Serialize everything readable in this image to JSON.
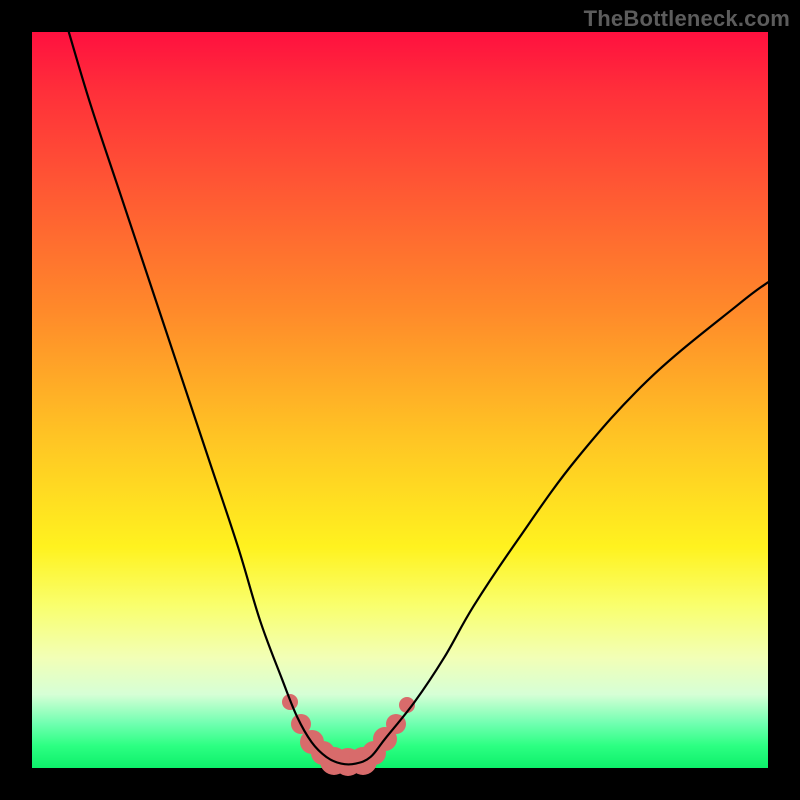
{
  "watermark": "TheBottleneck.com",
  "chart_data": {
    "type": "line",
    "title": "",
    "xlabel": "",
    "ylabel": "",
    "xlim": [
      0,
      100
    ],
    "ylim": [
      0,
      100
    ],
    "grid": false,
    "legend": false,
    "series": [
      {
        "name": "bottleneck-curve",
        "x": [
          5,
          8,
          12,
          16,
          20,
          24,
          28,
          31,
          34,
          36,
          38,
          40,
          42,
          44,
          46,
          48,
          52,
          56,
          60,
          66,
          74,
          84,
          96,
          100
        ],
        "y": [
          100,
          90,
          78,
          66,
          54,
          42,
          30,
          20,
          12,
          7,
          3.5,
          1.5,
          0.6,
          0.6,
          1.5,
          4,
          9,
          15,
          22,
          31,
          42,
          53,
          63,
          66
        ]
      }
    ],
    "markers": {
      "name": "highlight-dots",
      "color": "#d86b6b",
      "points": [
        {
          "x": 35.0,
          "y": 9.0,
          "r": 8
        },
        {
          "x": 36.5,
          "y": 6.0,
          "r": 10
        },
        {
          "x": 38.0,
          "y": 3.5,
          "r": 12
        },
        {
          "x": 39.5,
          "y": 2.0,
          "r": 12
        },
        {
          "x": 41.0,
          "y": 1.0,
          "r": 14
        },
        {
          "x": 43.0,
          "y": 0.8,
          "r": 14
        },
        {
          "x": 45.0,
          "y": 1.0,
          "r": 14
        },
        {
          "x": 46.5,
          "y": 2.0,
          "r": 12
        },
        {
          "x": 48.0,
          "y": 4.0,
          "r": 12
        },
        {
          "x": 49.5,
          "y": 6.0,
          "r": 10
        },
        {
          "x": 51.0,
          "y": 8.5,
          "r": 8
        }
      ]
    },
    "background_gradient": {
      "top": "#ff103f",
      "mid": "#fff21f",
      "bottom": "#0df06a"
    }
  }
}
